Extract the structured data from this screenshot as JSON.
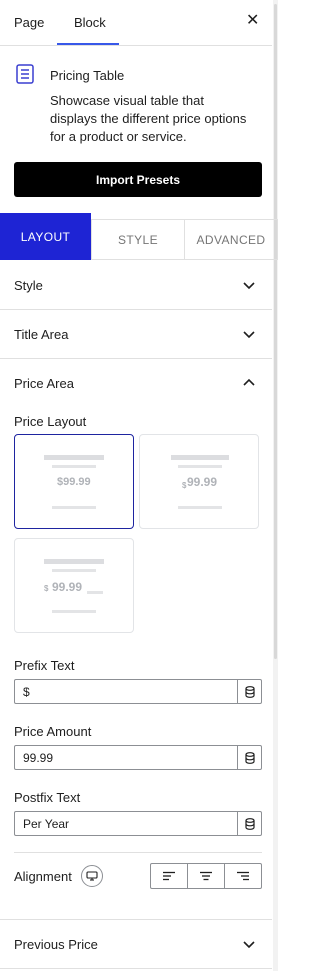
{
  "tabs": {
    "page": "Page",
    "block": "Block"
  },
  "block": {
    "title": "Pricing Table",
    "description": "Showcase visual table that displays the different price options for a product or service.",
    "import_label": "Import Presets"
  },
  "control_tabs": {
    "layout": "LAYOUT",
    "style": "STYLE",
    "advanced": "ADVANCED"
  },
  "panels": {
    "style": "Style",
    "title_area": "Title Area",
    "price_area": "Price Area",
    "previous_price": "Previous Price"
  },
  "price_area": {
    "layout_label": "Price Layout",
    "layouts": [
      {
        "sample": "$99.99",
        "selected": true
      },
      {
        "sample_currency": "$",
        "sample_amount": "99.99"
      },
      {
        "sample_currency": "$",
        "sample_amount": "99.99"
      }
    ],
    "prefix_label": "Prefix Text",
    "prefix_value": "$",
    "amount_label": "Price Amount",
    "amount_value": "99.99",
    "postfix_label": "Postfix Text",
    "postfix_value": "Per Year",
    "alignment_label": "Alignment"
  },
  "colors": {
    "accent": "#3858e9",
    "layout_tab": "#1e24d4",
    "selected_card": "#1e24a0"
  }
}
